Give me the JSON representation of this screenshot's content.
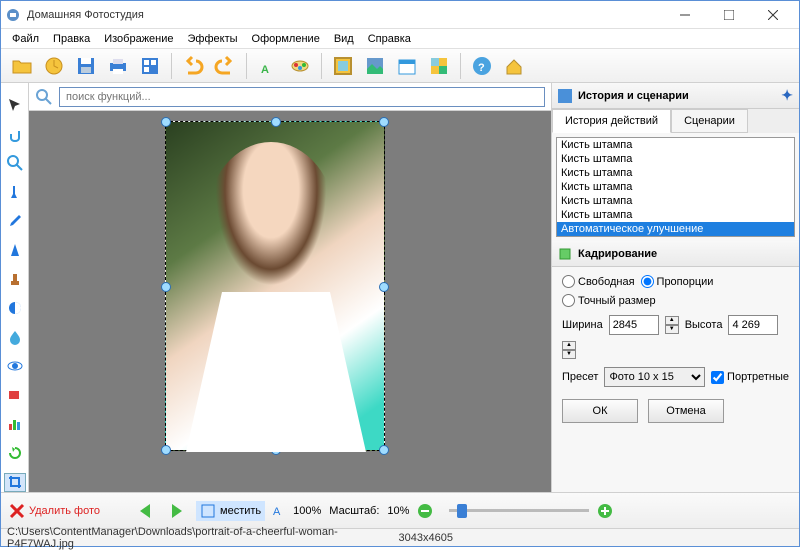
{
  "window": {
    "title": "Домашняя Фотостудия"
  },
  "menu": {
    "items": [
      "Файл",
      "Правка",
      "Изображение",
      "Эффекты",
      "Оформление",
      "Вид",
      "Справка"
    ]
  },
  "search": {
    "placeholder": "поиск функций..."
  },
  "right_panel": {
    "header": "История и сценарии",
    "tabs": {
      "history": "История действий",
      "scenarios": "Сценарии"
    },
    "history": {
      "items": [
        "Кисть штампа",
        "Кисть штампа",
        "Кисть штампа",
        "Кисть штампа",
        "Кисть штампа",
        "Кисть штампа",
        "Автоматическое улучшение"
      ]
    },
    "crop": {
      "title": "Кадрирование",
      "mode": {
        "free": "Свободная",
        "proportions": "Пропорции",
        "exact": "Точный размер"
      },
      "width_label": "Ширина",
      "width_value": "2845",
      "height_label": "Высота",
      "height_value": "4 269",
      "preset_label": "Пресет",
      "preset_value": "Фото 10 x 15",
      "portrait_label": "Портретные",
      "ok": "ОК",
      "cancel": "Отмена"
    }
  },
  "bottom": {
    "delete": "Удалить фото",
    "fit": "местить",
    "hundred": "100%",
    "scale_label": "Масштаб:",
    "scale_value": "10%"
  },
  "status": {
    "path": "C:\\Users\\ContentManager\\Downloads\\portrait-of-a-cheerful-woman-P4F7WAJ.jpg",
    "dimensions": "3043x4605"
  }
}
